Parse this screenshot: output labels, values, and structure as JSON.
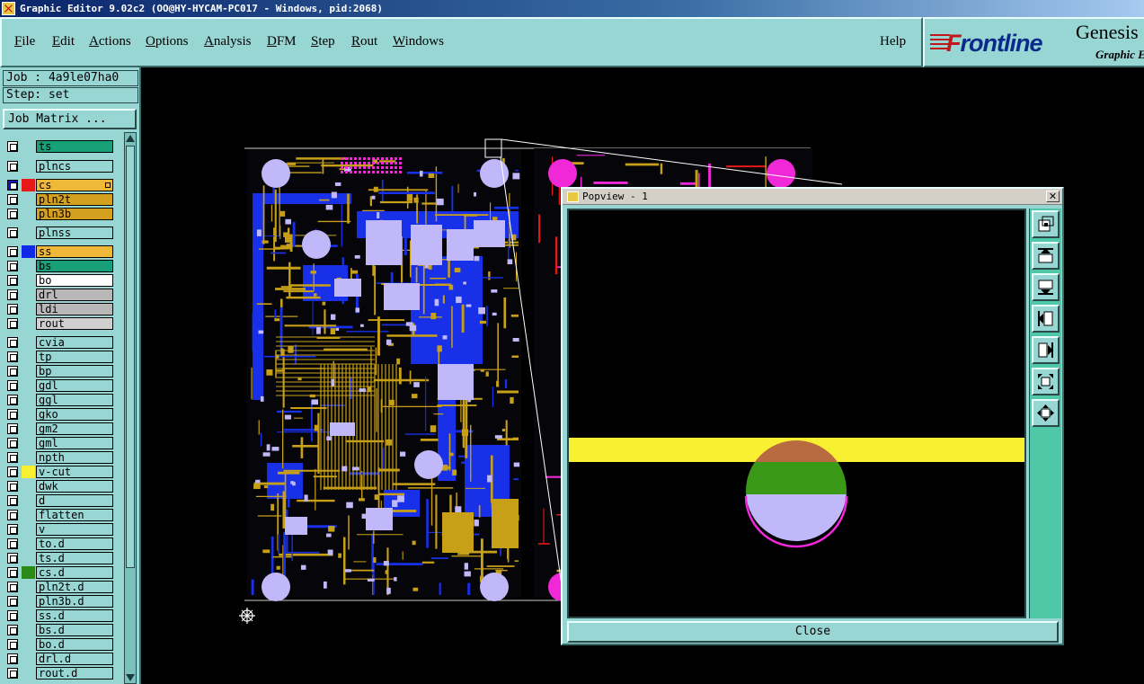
{
  "window": {
    "title": "Graphic Editor 9.02c2 (OO@HY-HYCAM-PC017 - Windows, pid:2068)"
  },
  "menu": {
    "items": [
      {
        "label": "File",
        "u": "F",
        "rest": "ile"
      },
      {
        "label": "Edit",
        "u": "E",
        "rest": "dit"
      },
      {
        "label": "Actions",
        "u": "A",
        "rest": "ctions"
      },
      {
        "label": "Options",
        "u": "O",
        "rest": "ptions"
      },
      {
        "label": "Analysis",
        "u": "A",
        "rest": "nalysis"
      },
      {
        "label": "DFM",
        "u": "D",
        "rest": "FM"
      },
      {
        "label": "Step",
        "u": "S",
        "rest": "tep"
      },
      {
        "label": "Rout",
        "u": "R",
        "rest": "out"
      },
      {
        "label": "Windows",
        "u": "W",
        "rest": "indows"
      }
    ],
    "help": "Help"
  },
  "logo": {
    "brand_first": "F",
    "brand_rest": "rontline",
    "product": "Genesis",
    "subtitle": "Graphic Editor"
  },
  "job": {
    "job_line": "Job : 4a9le07ha0",
    "step_line": "Step: set",
    "matrix_button": "Job Matrix ..."
  },
  "layers": [
    {
      "name": "ts",
      "color": "#18a078",
      "checked": false
    },
    {
      "name": "plncs",
      "color": "#98d6d4",
      "checked": false
    },
    {
      "name": "cs",
      "color": "#f0b838",
      "checked": true,
      "swatch": "#e81818"
    },
    {
      "name": "pln2t",
      "color": "#d4a020",
      "checked": false
    },
    {
      "name": "pln3b",
      "color": "#d4a020",
      "checked": false
    },
    {
      "name": "plnss",
      "color": "#98d6d4",
      "checked": false
    },
    {
      "name": "ss",
      "color": "#f0b838",
      "checked": false,
      "swatch": "#1028e8"
    },
    {
      "name": "bs",
      "color": "#18a078",
      "checked": false
    },
    {
      "name": "bo",
      "color": "#ffffff",
      "checked": false
    },
    {
      "name": "drl",
      "color": "#b8b8b8",
      "checked": false
    },
    {
      "name": "ldi",
      "color": "#b8b8b8",
      "checked": false
    },
    {
      "name": "rout",
      "color": "#d0d0d0",
      "checked": false
    },
    {
      "name": "cvia",
      "color": "#98d6d4",
      "checked": false
    },
    {
      "name": "tp",
      "color": "#98d6d4",
      "checked": false
    },
    {
      "name": "bp",
      "color": "#98d6d4",
      "checked": false
    },
    {
      "name": "gdl",
      "color": "#98d6d4",
      "checked": false
    },
    {
      "name": "ggl",
      "color": "#98d6d4",
      "checked": false
    },
    {
      "name": "gko",
      "color": "#98d6d4",
      "checked": false
    },
    {
      "name": "gm2",
      "color": "#98d6d4",
      "checked": false
    },
    {
      "name": "gml",
      "color": "#98d6d4",
      "checked": false
    },
    {
      "name": "npth",
      "color": "#98d6d4",
      "checked": false
    },
    {
      "name": "v-cut",
      "color": "#98d6d4",
      "checked": false,
      "swatch": "#f8f030"
    },
    {
      "name": "dwk",
      "color": "#98d6d4",
      "checked": false
    },
    {
      "name": "d",
      "color": "#98d6d4",
      "checked": false
    },
    {
      "name": "flatten",
      "color": "#98d6d4",
      "checked": false
    },
    {
      "name": "v",
      "color": "#98d6d4",
      "checked": false
    },
    {
      "name": "to.d",
      "color": "#98d6d4",
      "checked": false
    },
    {
      "name": "ts.d",
      "color": "#98d6d4",
      "checked": false
    },
    {
      "name": "cs.d",
      "color": "#98d6d4",
      "checked": false,
      "swatch": "#2a8a18"
    },
    {
      "name": "pln2t.d",
      "color": "#98d6d4",
      "checked": false
    },
    {
      "name": "pln3b.d",
      "color": "#98d6d4",
      "checked": false
    },
    {
      "name": "ss.d",
      "color": "#98d6d4",
      "checked": false
    },
    {
      "name": "bs.d",
      "color": "#98d6d4",
      "checked": false
    },
    {
      "name": "bo.d",
      "color": "#98d6d4",
      "checked": false
    },
    {
      "name": "drl.d",
      "color": "#98d6d4",
      "checked": false
    },
    {
      "name": "rout.d",
      "color": "#98d6d4",
      "checked": false
    }
  ],
  "popview": {
    "title": "Popview - 1",
    "close_button": "Close",
    "close_glyph": "✕"
  },
  "colors": {
    "panel_bg": "#98d6d4",
    "board_copper": "#c8a018",
    "board_blue": "#1830e8",
    "board_pad": "#c0b8f8",
    "board_magenta": "#f028d8",
    "vcut_yellow": "#f8f030"
  }
}
